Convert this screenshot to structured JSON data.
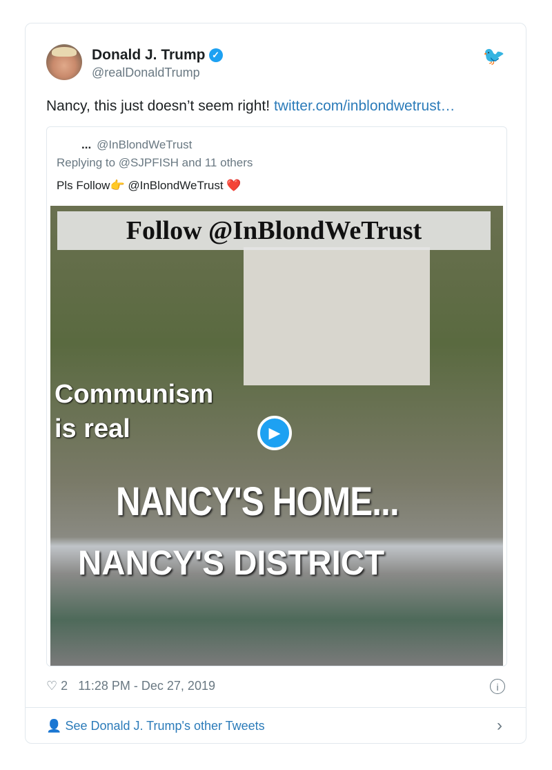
{
  "author": {
    "name": "Donald J. Trump",
    "handle": "@realDonaldTrump"
  },
  "tweet": {
    "text": "Nancy, this just doesn’t seem right!",
    "link": "twitter.com/inblondwetrust…"
  },
  "quoted": {
    "name_truncated": "...",
    "handle": "@InBlondWeTrust",
    "replying": "Replying to @SJPFISH and 11 others",
    "text": "Pls Follow👉 @InBlondWeTrust ❤️",
    "media_text": {
      "banner": "Follow @InBlondWeTrust",
      "line1": "Communism",
      "line2": "is real",
      "home": "NANCY'S HOME...",
      "district": "NANCY'S DISTRICT"
    }
  },
  "footer": {
    "likes": "2",
    "timestamp": "11:28 PM - Dec 27, 2019",
    "see_more": "See Donald J. Trump's other Tweets"
  },
  "colors": {
    "accent": "#1da1f2",
    "link": "#2b7bb9"
  }
}
